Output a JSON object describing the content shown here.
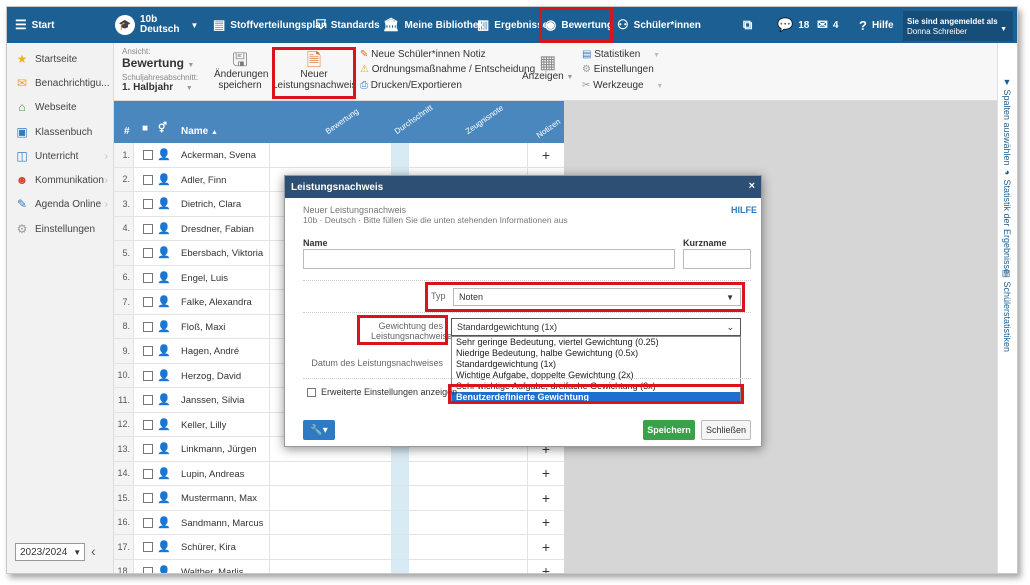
{
  "topnav": {
    "start": "Start",
    "class_top": "10b",
    "class_sub": "Deutsch",
    "stoffverteilungsplan": "Stoffverteilungsplan",
    "standards": "Standards",
    "bibliothek": "Meine Bibliothek",
    "ergebnisse": "Ergebnisse",
    "bewertung": "Bewertung",
    "schueler": "Schüler*innen",
    "chat_count": "18",
    "mail_count": "4",
    "hilfe": "Hilfe",
    "login_label": "Sie sind angemeldet als",
    "login_user": "Donna Schreiber"
  },
  "sidebar": {
    "items": [
      {
        "label": "Startseite",
        "icon": "star-icon"
      },
      {
        "label": "Benachrichtigu...",
        "icon": "envelope-icon"
      },
      {
        "label": "Webseite",
        "icon": "home-icon"
      },
      {
        "label": "Klassenbuch",
        "icon": "book-icon"
      },
      {
        "label": "Unterricht",
        "icon": "open-book-icon"
      },
      {
        "label": "Kommunikation",
        "icon": "chat-icon"
      },
      {
        "label": "Agenda Online",
        "icon": "pen-icon"
      },
      {
        "label": "Einstellungen",
        "icon": "gear-icon"
      }
    ],
    "year": "2023/2024"
  },
  "ribbon": {
    "ansicht_label": "Ansicht:",
    "ansicht_value": "Bewertung",
    "halbjahr_label": "Schuljahresabschnitt:",
    "halbjahr_value": "1. Halbjahr",
    "save_line1": "Änderungen",
    "save_line2": "speichern",
    "new_line1": "Neuer",
    "new_line2": "Leistungsnachweis",
    "notiz": "Neue Schüler*innen Notiz",
    "ordnung": "Ordnungsmaßnahme / Entscheidung",
    "drucken": "Drucken/Exportieren",
    "anzeigen": "Anzeigen",
    "statistiken": "Statistiken",
    "einstellungen": "Einstellungen",
    "werkzeuge": "Werkzeuge"
  },
  "right_strip": {
    "spalten": "Spalten auswählen",
    "statistik": "Statistik der Ergebnisse",
    "schuelerstatistiken": "Schülerstatistiken"
  },
  "grid": {
    "col_num": "#",
    "col_name": "Name",
    "col_bewertung": "Bewertung",
    "col_durchschnitt": "Durchschnitt",
    "col_zeugnisnote": "Zeugnisnote",
    "col_notizen": "Notizen",
    "plus": "+",
    "rows": [
      {
        "n": "1.",
        "name": "Ackerman, Svena"
      },
      {
        "n": "2.",
        "name": "Adler, Finn"
      },
      {
        "n": "3.",
        "name": "Dietrich, Clara"
      },
      {
        "n": "4.",
        "name": "Dresdner, Fabian"
      },
      {
        "n": "5.",
        "name": "Ebersbach, Viktoria"
      },
      {
        "n": "6.",
        "name": "Engel, Luis"
      },
      {
        "n": "7.",
        "name": "Falke, Alexandra"
      },
      {
        "n": "8.",
        "name": "Floß, Maxi"
      },
      {
        "n": "9.",
        "name": "Hagen, André"
      },
      {
        "n": "10.",
        "name": "Herzog, David"
      },
      {
        "n": "11.",
        "name": "Janssen, Silvia"
      },
      {
        "n": "12.",
        "name": "Keller, Lilly"
      },
      {
        "n": "13.",
        "name": "Linkmann, Jürgen"
      },
      {
        "n": "14.",
        "name": "Lupin, Andreas"
      },
      {
        "n": "15.",
        "name": "Mustermann, Max"
      },
      {
        "n": "16.",
        "name": "Sandmann, Marcus"
      },
      {
        "n": "17.",
        "name": "Schürer, Kira"
      },
      {
        "n": "18.",
        "name": "Walther, Marlis"
      }
    ]
  },
  "modal": {
    "title": "Leistungsnachweis",
    "close": "×",
    "subtitle": "Neuer Leistungsnachweis",
    "info": "10b · Deutsch · Bitte füllen Sie die unten stehenden Informationen aus",
    "hilfe": "HILFE",
    "name_label": "Name",
    "kurzname_label": "Kurzname",
    "typ_label": "Typ",
    "typ_value": "Noten",
    "gewichtung_label1": "Gewichtung des",
    "gewichtung_label2": "Leistungsnachweises",
    "gewichtung_value": "Standardgewichtung (1x)",
    "datum_label": "Datum des Leistungsnachweises",
    "erweitert_label": "Erweiterte Einstellungen anzeigen",
    "save": "Speichern",
    "close_btn": "Schließen",
    "options": [
      "Sehr geringe Bedeutung, viertel Gewichtung (0.25)",
      "Niedrige Bedeutung, halbe Gewichtung (0.5x)",
      "Standardgewichtung (1x)",
      "Wichtige Aufgabe, doppelte Gewichtung (2x)",
      "Sehr wichtige Aufgabe, dreifache Gewichtung (3x)",
      "Benutzerdefinierte Gewichtung"
    ],
    "selected_option_index": 5
  },
  "colors": {
    "nav_blue": "#1c5f93",
    "grid_header": "#4a87bf",
    "highlight_red": "#d9141c",
    "save_green": "#3aa14a",
    "select_blue": "#1e6fd0"
  }
}
